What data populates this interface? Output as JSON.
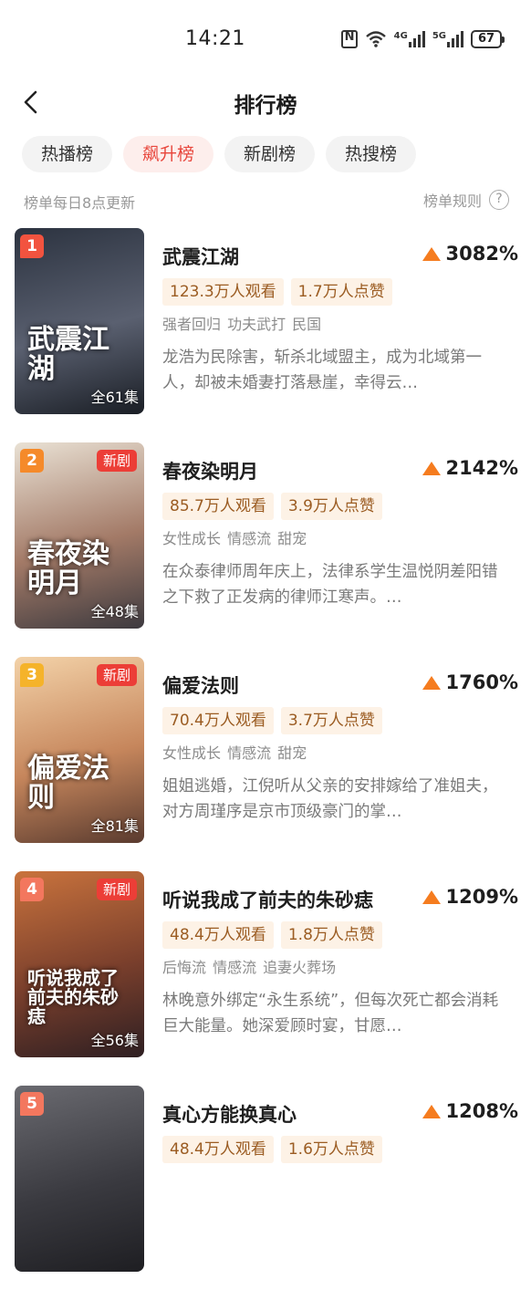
{
  "status_bar": {
    "time": "14:21",
    "net1": "4G",
    "net2": "5G",
    "battery": "67"
  },
  "header": {
    "title": "排行榜"
  },
  "tabs": [
    {
      "label": "热播榜",
      "active": false
    },
    {
      "label": "飙升榜",
      "active": true
    },
    {
      "label": "新剧榜",
      "active": false
    },
    {
      "label": "热搜榜",
      "active": false
    }
  ],
  "subbar": {
    "note": "榜单每日8点更新",
    "rules": "榜单规则",
    "rules_icon": "?"
  },
  "dramas": [
    {
      "rank": "1",
      "rank_color": "#f2533f",
      "new_tag": "",
      "episodes": "全61集",
      "poster_title": "武震江湖",
      "poster_colors": [
        "#2c3340",
        "#5a6070",
        "#1a1e25"
      ],
      "name": "武震江湖",
      "rise": "3082%",
      "views": "123.3万人观看",
      "likes": "1.7万人点赞",
      "tags": "强者回归 功夫武打 民国",
      "desc": "龙浩为民除害，斩杀北域盟主，成为北域第一人，却被未婚妻打落悬崖，幸得云…"
    },
    {
      "rank": "2",
      "rank_color": "#f58a2a",
      "new_tag": "新剧",
      "episodes": "全48集",
      "poster_title": "春夜染明月",
      "poster_colors": [
        "#e9e1d4",
        "#a37a67",
        "#3d3a3f"
      ],
      "name": "春夜染明月",
      "rise": "2142%",
      "views": "85.7万人观看",
      "likes": "3.9万人点赞",
      "tags": "女性成长 情感流 甜宠",
      "desc": "在众泰律师周年庆上，法律系学生温悦阴差阳错之下救了正发病的律师江寒声。…"
    },
    {
      "rank": "3",
      "rank_color": "#f5b32a",
      "new_tag": "新剧",
      "episodes": "全81集",
      "poster_title": "偏爱法则",
      "poster_colors": [
        "#f3d2a8",
        "#c6865c",
        "#5a3b2f"
      ],
      "name": "偏爱法则",
      "rise": "1760%",
      "views": "70.4万人观看",
      "likes": "3.7万人点赞",
      "tags": "女性成长 情感流 甜宠",
      "desc": "姐姐逃婚，江倪听从父亲的安排嫁给了准姐夫，对方周瑾序是京市顶级豪门的掌…"
    },
    {
      "rank": "4",
      "rank_color": "#f3775e",
      "new_tag": "新剧",
      "episodes": "全56集",
      "poster_title": "听说我成了前夫的朱砂痣",
      "poster_colors": [
        "#c9733d",
        "#7a3f2c",
        "#2e1f22"
      ],
      "name": "听说我成了前夫的朱砂痣",
      "rise": "1209%",
      "views": "48.4万人观看",
      "likes": "1.8万人点赞",
      "tags": "后悔流 情感流 追妻火葬场",
      "desc": "林晚意外绑定“永生系统”，但每次死亡都会消耗巨大能量。她深爱顾时宴，甘愿…"
    },
    {
      "rank": "5",
      "rank_color": "#f3775e",
      "new_tag": "",
      "episodes": "",
      "poster_title": "",
      "poster_colors": [
        "#6a6a70",
        "#3a3a40",
        "#1e1e22"
      ],
      "name": "真心方能换真心",
      "rise": "1208%",
      "views": "48.4万人观看",
      "likes": "1.6万人点赞",
      "tags": "",
      "desc": ""
    }
  ]
}
